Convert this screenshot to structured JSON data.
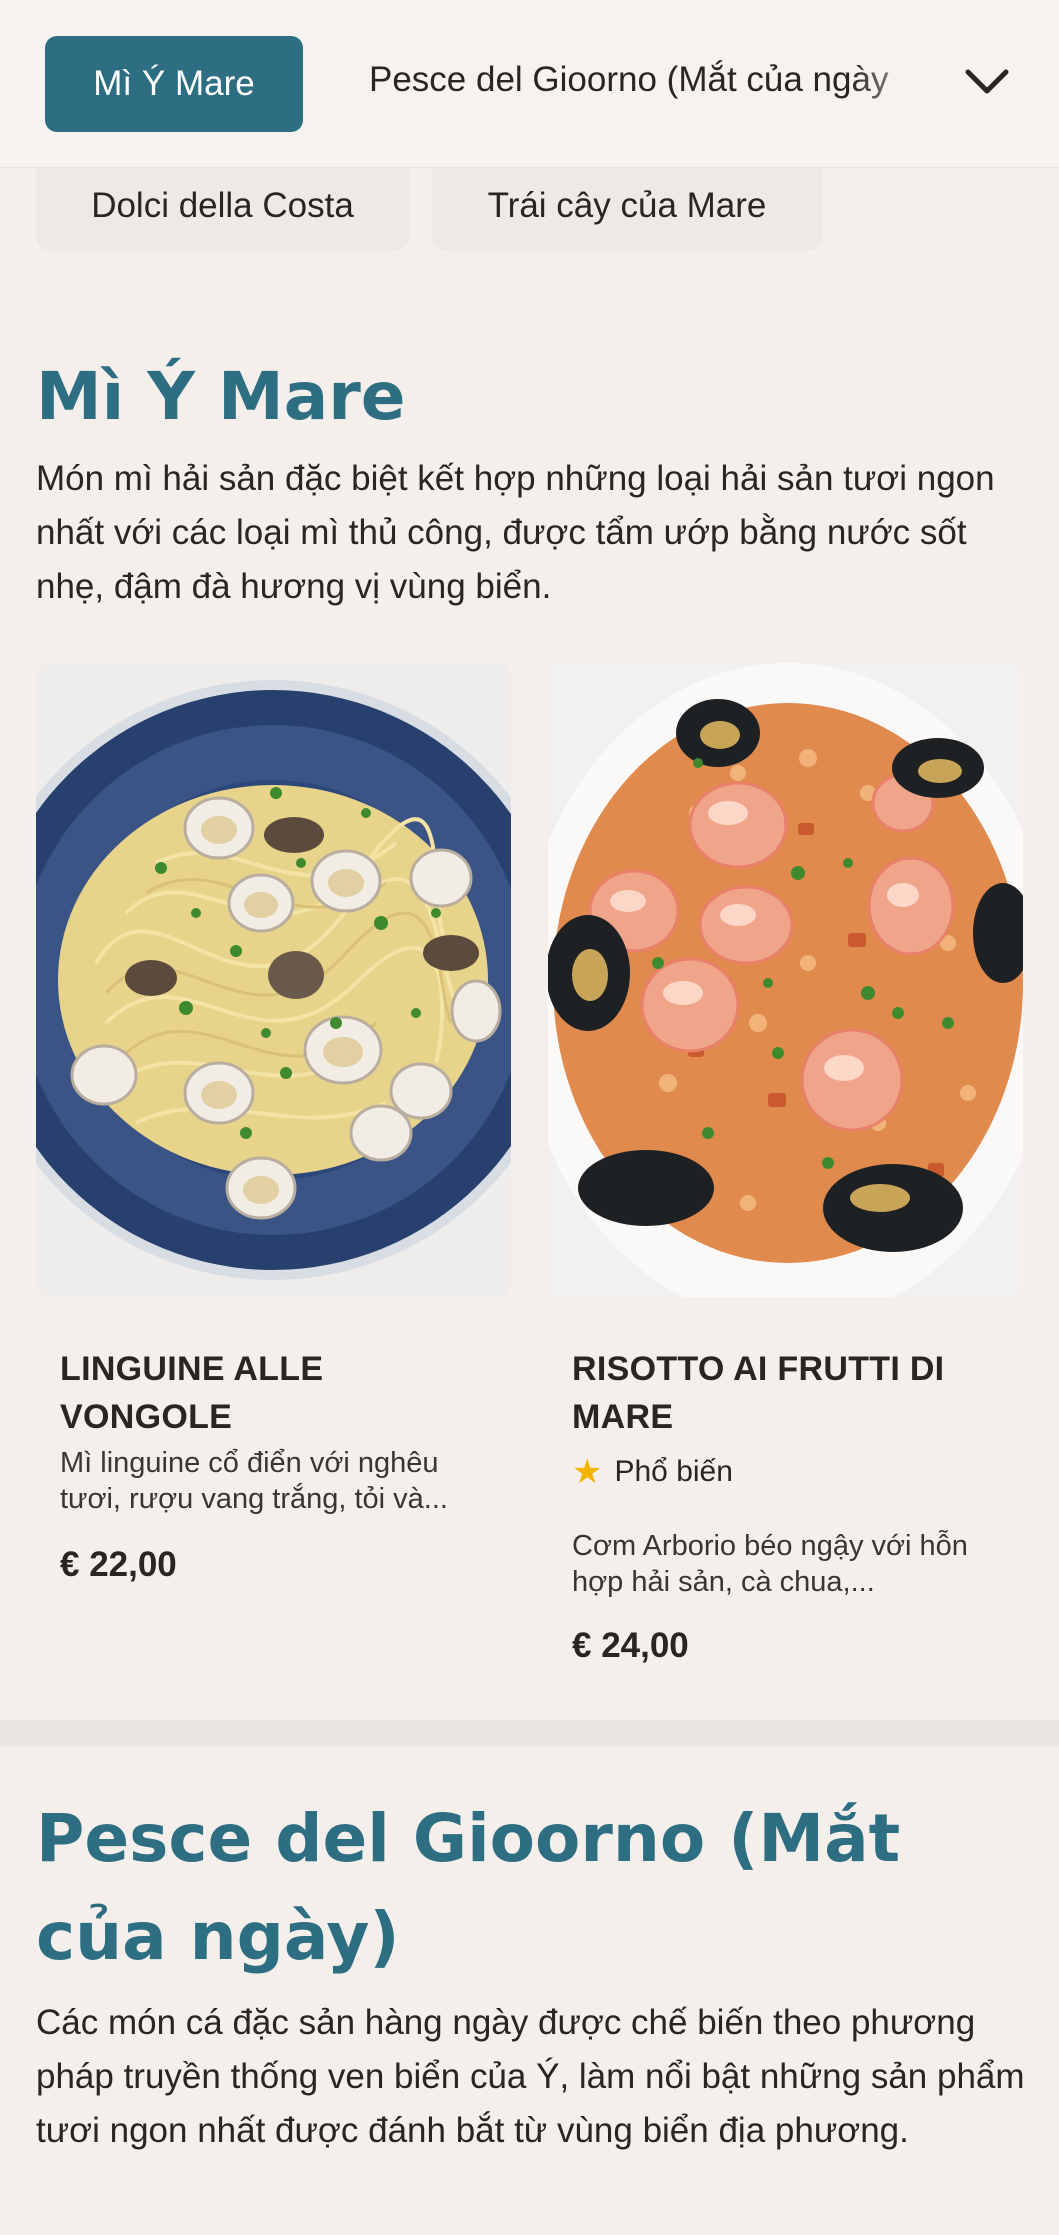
{
  "nav": {
    "active_category": "Mì Ý Mare",
    "next_category": "Pesce del Gioorno (Mắt của ngày",
    "chips": [
      "Dolci della Costa",
      "Trái cây của Mare"
    ]
  },
  "section1": {
    "title": "Mì Ý Mare",
    "description": "Món mì hải sản đặc biệt kết hợp những loại hải sản tươi ngon nhất với các loại mì thủ công, được tẩm ướp bằng nước sốt nhẹ, đậm đà hương vị vùng biển.",
    "items": [
      {
        "name": "LINGUINE ALLE VONGOLE",
        "description": "Mì linguine cổ điển với nghêu tươi, rượu vang trắng, tỏi và...",
        "price": "€ 22,00"
      },
      {
        "name": "RISOTTO AI FRUTTI DI MARE",
        "badge": "Phổ biến",
        "description": "Cơm Arborio béo ngậy với hỗn hợp hải sản, cà chua,...",
        "price": "€ 24,00"
      }
    ]
  },
  "section2": {
    "title": "Pesce del Gioorno (Mắt của ngày)",
    "description": "Các món cá đặc sản hàng ngày được chế biến theo phương pháp truyền thống ven biển của Ý, làm nổi bật những sản phẩm tươi ngon nhất được đánh bắt từ vùng biển địa phương."
  },
  "colors": {
    "accent": "#2e6e82",
    "background": "#f5efeb",
    "star": "#f2b400"
  },
  "icons": [
    "chevron-down-icon",
    "star-icon"
  ]
}
